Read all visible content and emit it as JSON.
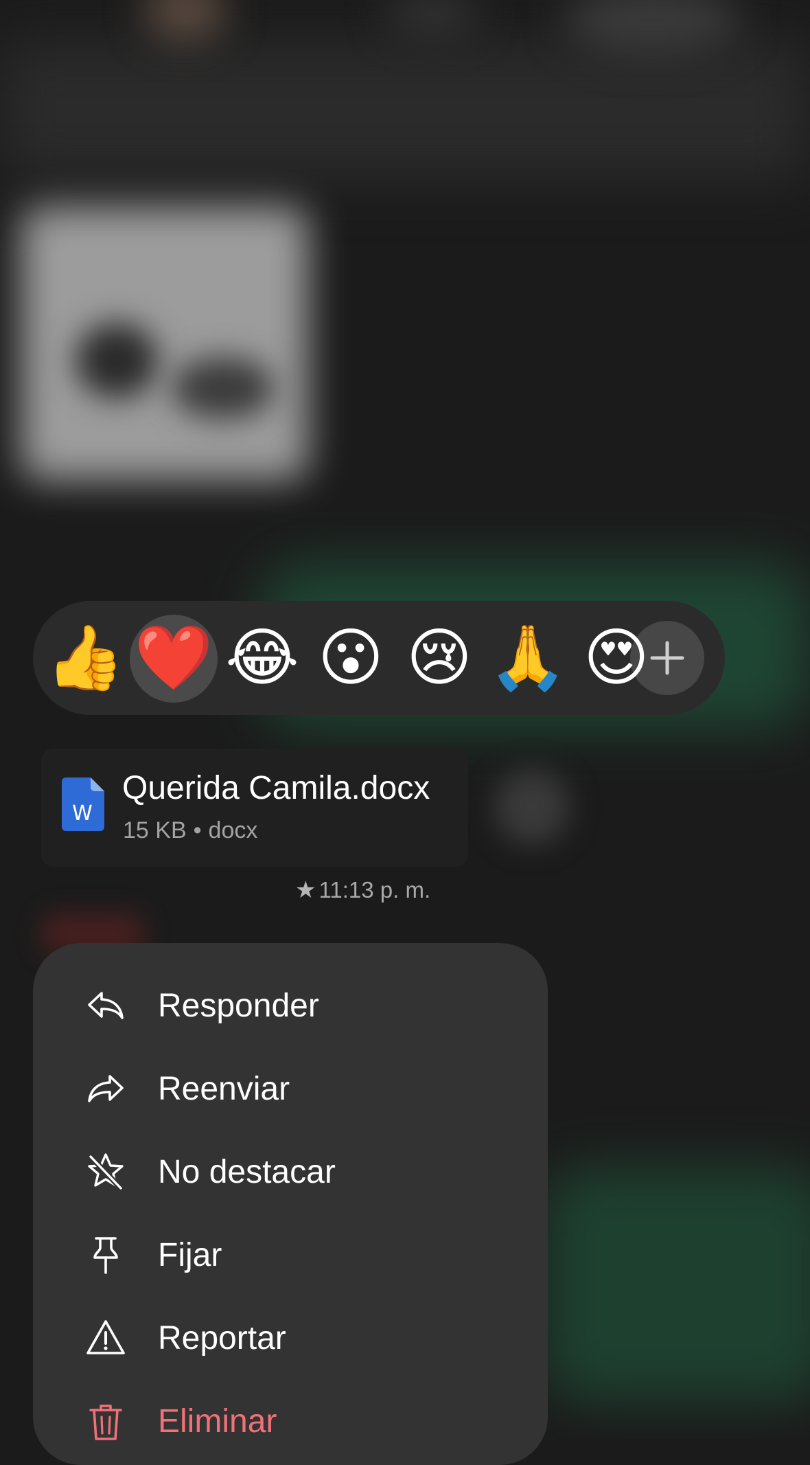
{
  "reactions": {
    "items": [
      {
        "emoji": "👍",
        "name": "thumbs-up"
      },
      {
        "emoji": "❤️",
        "name": "red-heart",
        "selected": true
      },
      {
        "emoji": "😂",
        "name": "tears-of-joy"
      },
      {
        "emoji": "😮",
        "name": "surprised"
      },
      {
        "emoji": "😢",
        "name": "crying"
      },
      {
        "emoji": "🙏",
        "name": "folded-hands"
      },
      {
        "emoji": "😍",
        "name": "heart-eyes"
      }
    ],
    "add_icon": "plus-icon"
  },
  "message": {
    "file_name": "Querida Camila.docx",
    "file_size": "15 KB",
    "separator": "•",
    "file_type": "docx",
    "file_icon": "word-document-icon",
    "file_icon_letter": "W",
    "star_icon": "★",
    "time": "11:13 p. m."
  },
  "menu": {
    "items": [
      {
        "label": "Responder",
        "icon": "reply-icon"
      },
      {
        "label": "Reenviar",
        "icon": "forward-icon"
      },
      {
        "label": "No destacar",
        "icon": "unstar-icon"
      },
      {
        "label": "Fijar",
        "icon": "pin-icon"
      },
      {
        "label": "Reportar",
        "icon": "warning-icon"
      },
      {
        "label": "Eliminar",
        "icon": "trash-icon",
        "danger": true
      }
    ]
  },
  "colors": {
    "menu_background": "#333333",
    "reaction_bar_background": "#2b2b2b",
    "danger": "#f07178",
    "word_blue": "#2f6bd6"
  }
}
